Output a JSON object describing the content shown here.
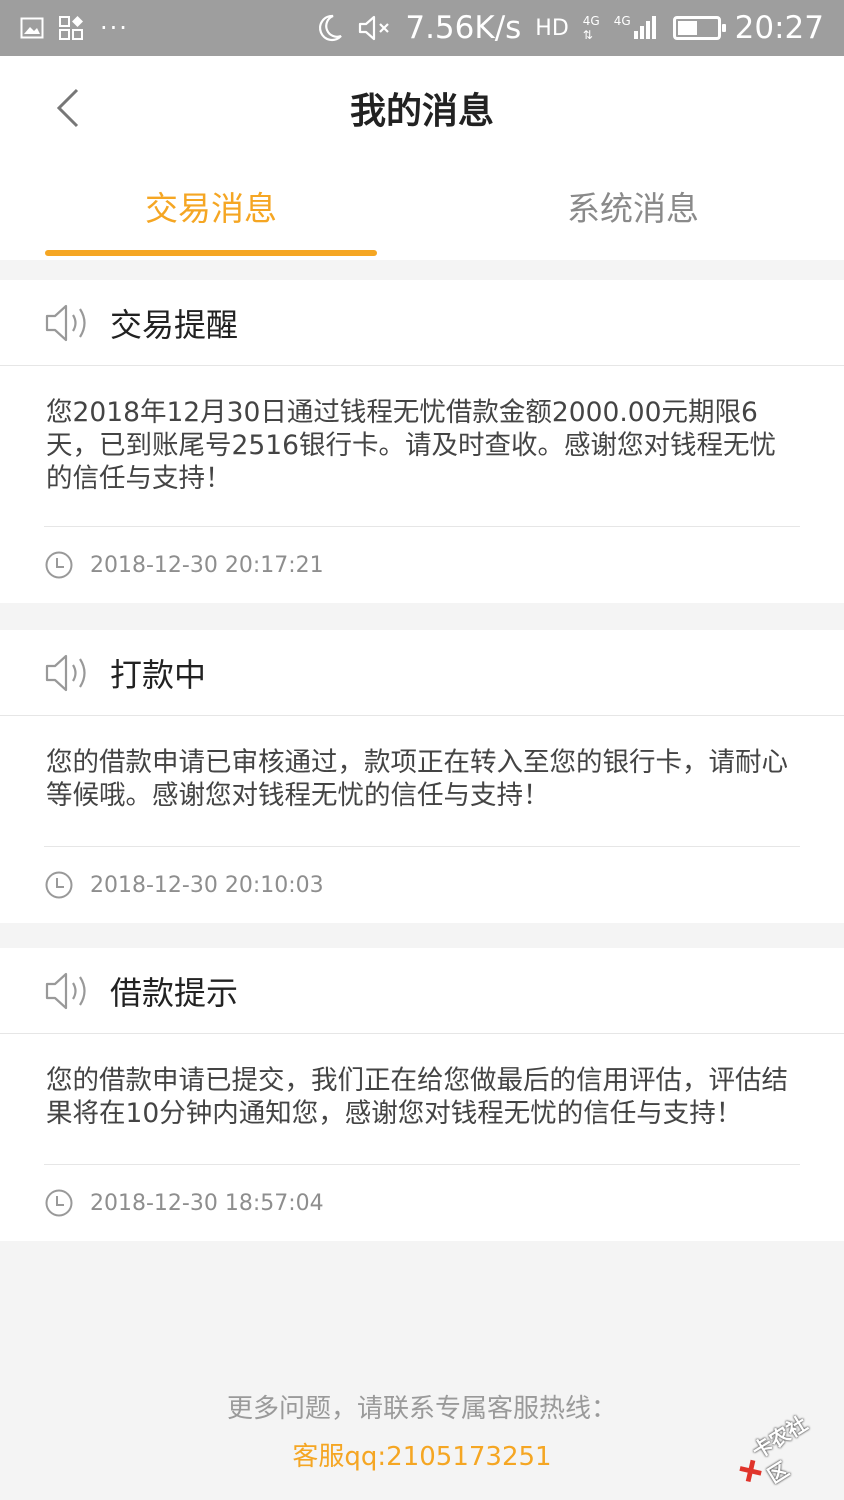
{
  "status_bar": {
    "speed": "7.56K/s",
    "network": "HD",
    "signal_type_1": "4G",
    "signal_type_2": "4G",
    "time": "20:27",
    "dots": "···"
  },
  "header": {
    "title": "我的消息"
  },
  "tabs": [
    {
      "label": "交易消息",
      "active": true
    },
    {
      "label": "系统消息",
      "active": false
    }
  ],
  "messages": [
    {
      "title": "交易提醒",
      "body": "您2018年12月30日通过钱程无忧借款金额2000.00元期限6天，已到账尾号2516银行卡。请及时查收。感谢您对钱程无忧的信任与支持！",
      "time": "2018-12-30 20:17:21"
    },
    {
      "title": "打款中",
      "body": "您的借款申请已审核通过，款项正在转入至您的银行卡，请耐心等候哦。感谢您对钱程无忧的信任与支持！",
      "time": "2018-12-30 20:10:03"
    },
    {
      "title": "借款提示",
      "body": "您的借款申请已提交，我们正在给您做最后的信用评估，评估结果将在10分钟内通知您，感谢您对钱程无忧的信任与支持！",
      "time": "2018-12-30 18:57:04"
    }
  ],
  "footer": {
    "note": "更多问题，请联系专属客服热线：",
    "qq": "客服qq:2105173251"
  },
  "watermark": {
    "text": "卡农社区"
  },
  "colors": {
    "accent": "#f5a623",
    "status_bar": "#9e9e9e"
  }
}
